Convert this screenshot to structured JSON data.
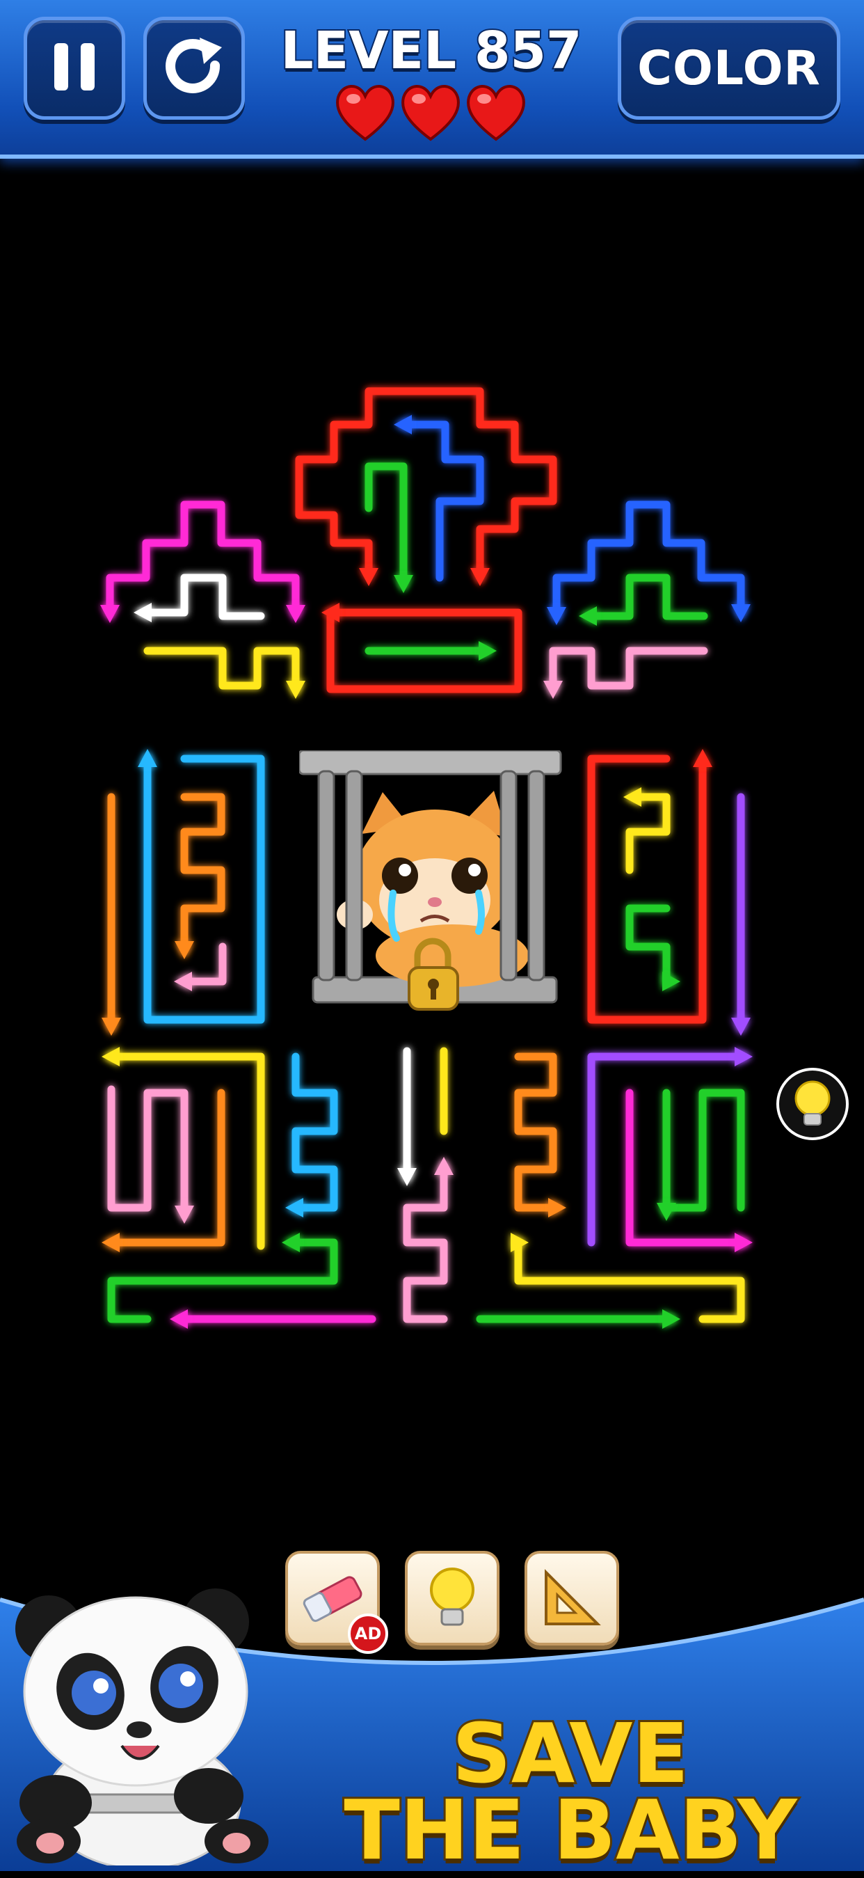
{
  "header": {
    "level_label": "LEVEL 857",
    "color_button_label": "COLOR",
    "lives": 3
  },
  "board": {
    "icons": [
      "pause-icon",
      "restart-icon",
      "heart-icon",
      "padlock-icon",
      "lightbulb-icon"
    ]
  },
  "tools": {
    "eraser": {
      "icon": "eraser-icon",
      "badge": "AD"
    },
    "hint": {
      "icon": "lightbulb-icon"
    },
    "ruler": {
      "icon": "set-square-icon"
    }
  },
  "promo": {
    "line1": "SAVE",
    "line2": "THE BABY"
  },
  "colors": {
    "red": "#ff2a1a",
    "blue": "#2563ff",
    "green": "#22d02a",
    "magenta": "#ff2bd6",
    "yellow": "#ffe81a",
    "pink": "#ff9ed0",
    "orange": "#ff8a1a",
    "cyan": "#27b8ff",
    "purple": "#a24dff",
    "white": "#ffffff"
  }
}
